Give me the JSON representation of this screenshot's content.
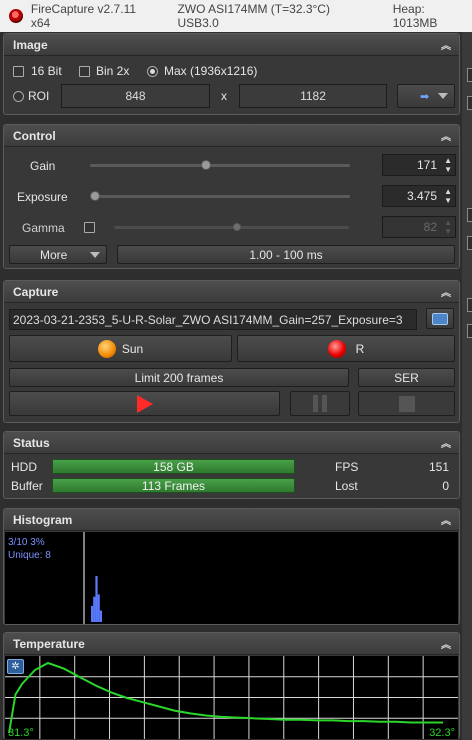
{
  "window": {
    "app_title": "FireCapture v2.7.11 x64",
    "camera": "ZWO ASI174MM (T=32.3°C) USB3.0",
    "heap": "Heap: 1013MB"
  },
  "image_panel": {
    "title": "Image",
    "bit16_label": "16 Bit",
    "bin2x_label": "Bin 2x",
    "max_label": "Max (1936x1216)",
    "roi_label": "ROI",
    "roi_width": "848",
    "x_label": "x",
    "roi_height": "1182",
    "arrow_glyph": "➡"
  },
  "control_panel": {
    "title": "Control",
    "gain_label": "Gain",
    "gain_value": "171",
    "gain_level": 0.445,
    "exposure_label": "Exposure",
    "exposure_value": "3.475",
    "exposure_level": 0.0,
    "gamma_label": "Gamma",
    "gamma_value": "82",
    "gamma_level": 0.53,
    "more_label": "More",
    "range_label": "1.00 - 100 ms"
  },
  "capture_panel": {
    "title": "Capture",
    "filename": "2023-03-21-2353_5-U-R-Solar_ZWO ASI174MM_Gain=257_Exposure=3",
    "profile_sun_label": "Sun",
    "profile_r_label": "R",
    "limit_label": "Limit 200 frames",
    "format_label": "SER"
  },
  "status_panel": {
    "title": "Status",
    "hdd_label": "HDD",
    "hdd_value": "158 GB",
    "buffer_label": "Buffer",
    "buffer_value": "113 Frames",
    "fps_label": "FPS",
    "fps_value": "151",
    "lost_label": "Lost",
    "lost_value": "0"
  },
  "histogram_panel": {
    "title": "Histogram",
    "stats_line1": "3/10 3%",
    "stats_line2": "Unique: 8"
  },
  "temperature_panel": {
    "title": "Temperature",
    "min_label": "31.3°",
    "max_label": "32.3°"
  },
  "colors": {
    "accent_green": "#3b8a3b",
    "histogram_blue": "#5a7bff",
    "temperature_line": "#2bd62b",
    "play_red": "#ff2a2a"
  },
  "chart_data": [
    {
      "type": "bar",
      "title": "Histogram",
      "x": [
        9,
        10,
        11,
        12,
        13
      ],
      "values": [
        0.35,
        0.55,
        1.0,
        0.6,
        0.25
      ],
      "note_text": [
        "3/10 3%",
        "Unique: 8"
      ]
    },
    {
      "type": "line",
      "title": "Temperature",
      "ylim": [
        31.3,
        32.3
      ],
      "series": [
        {
          "values": [
            31.3,
            31.85,
            32.0,
            32.1,
            32.2,
            32.25,
            32.3,
            32.22,
            32.1,
            31.98,
            31.88,
            31.8,
            31.74,
            31.68,
            31.62,
            31.58,
            31.55,
            31.53,
            31.52,
            31.51,
            31.5,
            31.49,
            31.49,
            31.48,
            31.48,
            31.47,
            31.47,
            31.46,
            31.46,
            31.45,
            31.45,
            31.45
          ]
        }
      ]
    }
  ]
}
